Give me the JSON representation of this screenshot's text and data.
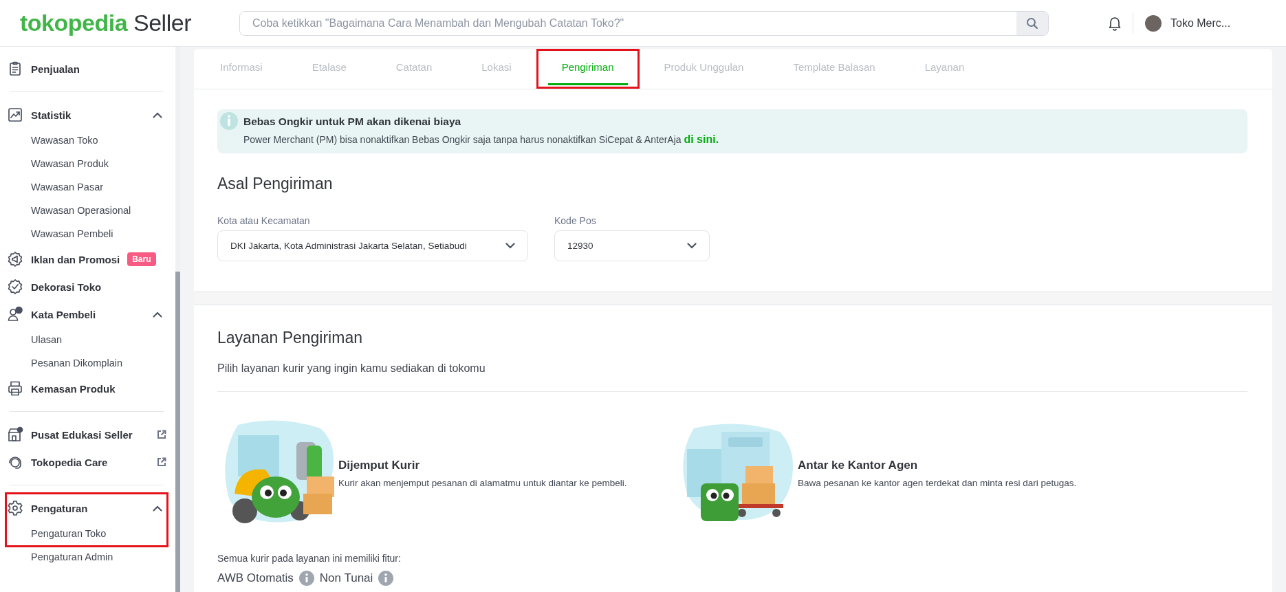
{
  "header": {
    "logo_brand": "tokopedia",
    "logo_suffix": "Seller",
    "search": {
      "placeholder": "Coba ketikkan \"Bagaimana Cara Menambah dan Mengubah Catatan Toko?\""
    },
    "shop_name": "Toko Merc..."
  },
  "sidebar": {
    "sections": [
      {
        "items": [
          {
            "label": "Penjualan"
          }
        ]
      },
      {
        "items": [
          {
            "label": "Statistik",
            "expanded": true,
            "children": [
              {
                "label": "Wawasan Toko"
              },
              {
                "label": "Wawasan Produk"
              },
              {
                "label": "Wawasan Pasar"
              },
              {
                "label": "Wawasan Operasional"
              },
              {
                "label": "Wawasan Pembeli"
              }
            ]
          },
          {
            "label": "Iklan dan Promosi",
            "badge": "Baru"
          },
          {
            "label": "Dekorasi Toko"
          },
          {
            "label": "Kata Pembeli",
            "expanded": true,
            "children": [
              {
                "label": "Ulasan"
              },
              {
                "label": "Pesanan Dikomplain"
              }
            ]
          },
          {
            "label": "Kemasan Produk"
          }
        ]
      },
      {
        "items": [
          {
            "label": "Pusat Edukasi Seller",
            "external": true
          },
          {
            "label": "Tokopedia Care",
            "external": true
          }
        ]
      },
      {
        "items": [
          {
            "label": "Pengaturan",
            "expanded": true,
            "highlighted": true,
            "children": [
              {
                "label": "Pengaturan Toko",
                "highlighted": true
              },
              {
                "label": "Pengaturan Admin"
              }
            ]
          }
        ]
      }
    ]
  },
  "tabs": [
    {
      "label": "Informasi",
      "selected": false,
      "highlighted": false
    },
    {
      "label": "Etalase",
      "selected": false,
      "highlighted": false
    },
    {
      "label": "Catatan",
      "selected": false,
      "highlighted": false
    },
    {
      "label": "Lokasi",
      "selected": false,
      "highlighted": false
    },
    {
      "label": "Pengiriman",
      "selected": true,
      "highlighted": true
    },
    {
      "label": "Produk Unggulan",
      "selected": false,
      "highlighted": false
    },
    {
      "label": "Template Balasan",
      "selected": false,
      "highlighted": false
    },
    {
      "label": "Layanan",
      "selected": false,
      "highlighted": false
    }
  ],
  "banner": {
    "title": "Bebas Ongkir untuk PM akan dikenai biaya",
    "text": "Power Merchant (PM) bisa nonaktifkan Bebas Ongkir saja tanpa harus nonaktifkan SiCepat & AnterAja",
    "link": "di sini."
  },
  "origin": {
    "title": "Asal Pengiriman",
    "fields": [
      {
        "label": "Kota atau Kecamatan",
        "value": "DKI Jakarta, Kota Administrasi Jakarta Selatan, Setiabudi"
      },
      {
        "label": "Kode Pos",
        "value": "12930"
      }
    ]
  },
  "services": {
    "title": "Layanan Pengiriman",
    "subtitle": "Pilih layanan kurir yang ingin kamu sediakan di tokomu",
    "options": [
      {
        "title": "Dijemput Kurir",
        "description": "Kurir akan menjemput pesanan di alamatmu untuk diantar ke pembeli."
      },
      {
        "title": "Antar ke Kantor Agen",
        "description": "Bawa pesanan ke kantor agen terdekat dan minta resi dari petugas."
      }
    ],
    "features_intro": "Semua kurir pada layanan ini memiliki fitur:",
    "features": [
      "AWB Otomatis",
      "Non Tunai"
    ]
  }
}
